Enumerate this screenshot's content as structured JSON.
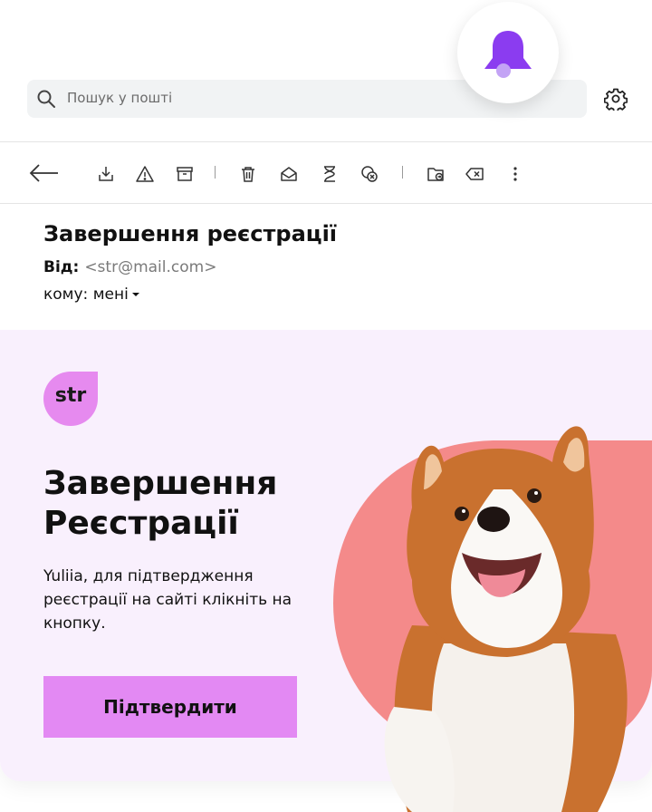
{
  "search": {
    "placeholder": "Пошук у пошті"
  },
  "email": {
    "subject": "Завершення реєстрації",
    "from_label": "Від:",
    "from_address": "<str@mail.com>",
    "to_label": "кому:",
    "to_value": "мені"
  },
  "promo": {
    "logo_text": "str",
    "title_line1": "Завершення",
    "title_line2": "Реєстрації",
    "body": "Yuliia, для підтвердження реєстрації на сайті клікніть на кнопку.",
    "button_label": "Підтвердити"
  },
  "icons": {
    "notification": "bell-icon",
    "settings": "gear-icon",
    "toolbar": [
      "back-arrow-icon",
      "download-icon",
      "report-icon",
      "archive-icon",
      "delete-icon",
      "mark-read-icon",
      "snooze-icon",
      "unsubscribe-icon",
      "move-folder-icon",
      "clear-icon",
      "more-icon"
    ]
  },
  "colors": {
    "accent": "#e389f3",
    "bell": "#8b3cf0",
    "promo_bg": "#f9f0fd",
    "circle": "#f48a8a"
  }
}
